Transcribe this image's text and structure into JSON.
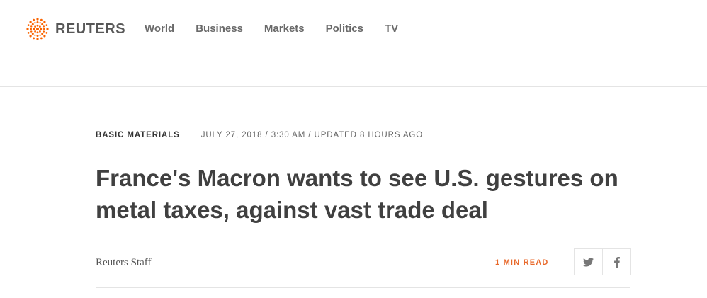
{
  "brand": {
    "name": "REUTERS",
    "logo_color": "#fa6400"
  },
  "nav": {
    "items": [
      {
        "label": "World"
      },
      {
        "label": "Business"
      },
      {
        "label": "Markets"
      },
      {
        "label": "Politics"
      },
      {
        "label": "TV"
      }
    ]
  },
  "article": {
    "section": "BASIC MATERIALS",
    "dateline": "JULY 27, 2018 / 3:30 AM / UPDATED 8 HOURS AGO",
    "headline": "France's Macron wants to see U.S. gestures on metal taxes, against vast trade deal",
    "byline": "Reuters Staff",
    "read_time": "1 MIN READ",
    "accent_color": "#e8692b"
  },
  "share": {
    "buttons": [
      {
        "icon": "twitter-icon"
      },
      {
        "icon": "facebook-icon"
      }
    ]
  }
}
